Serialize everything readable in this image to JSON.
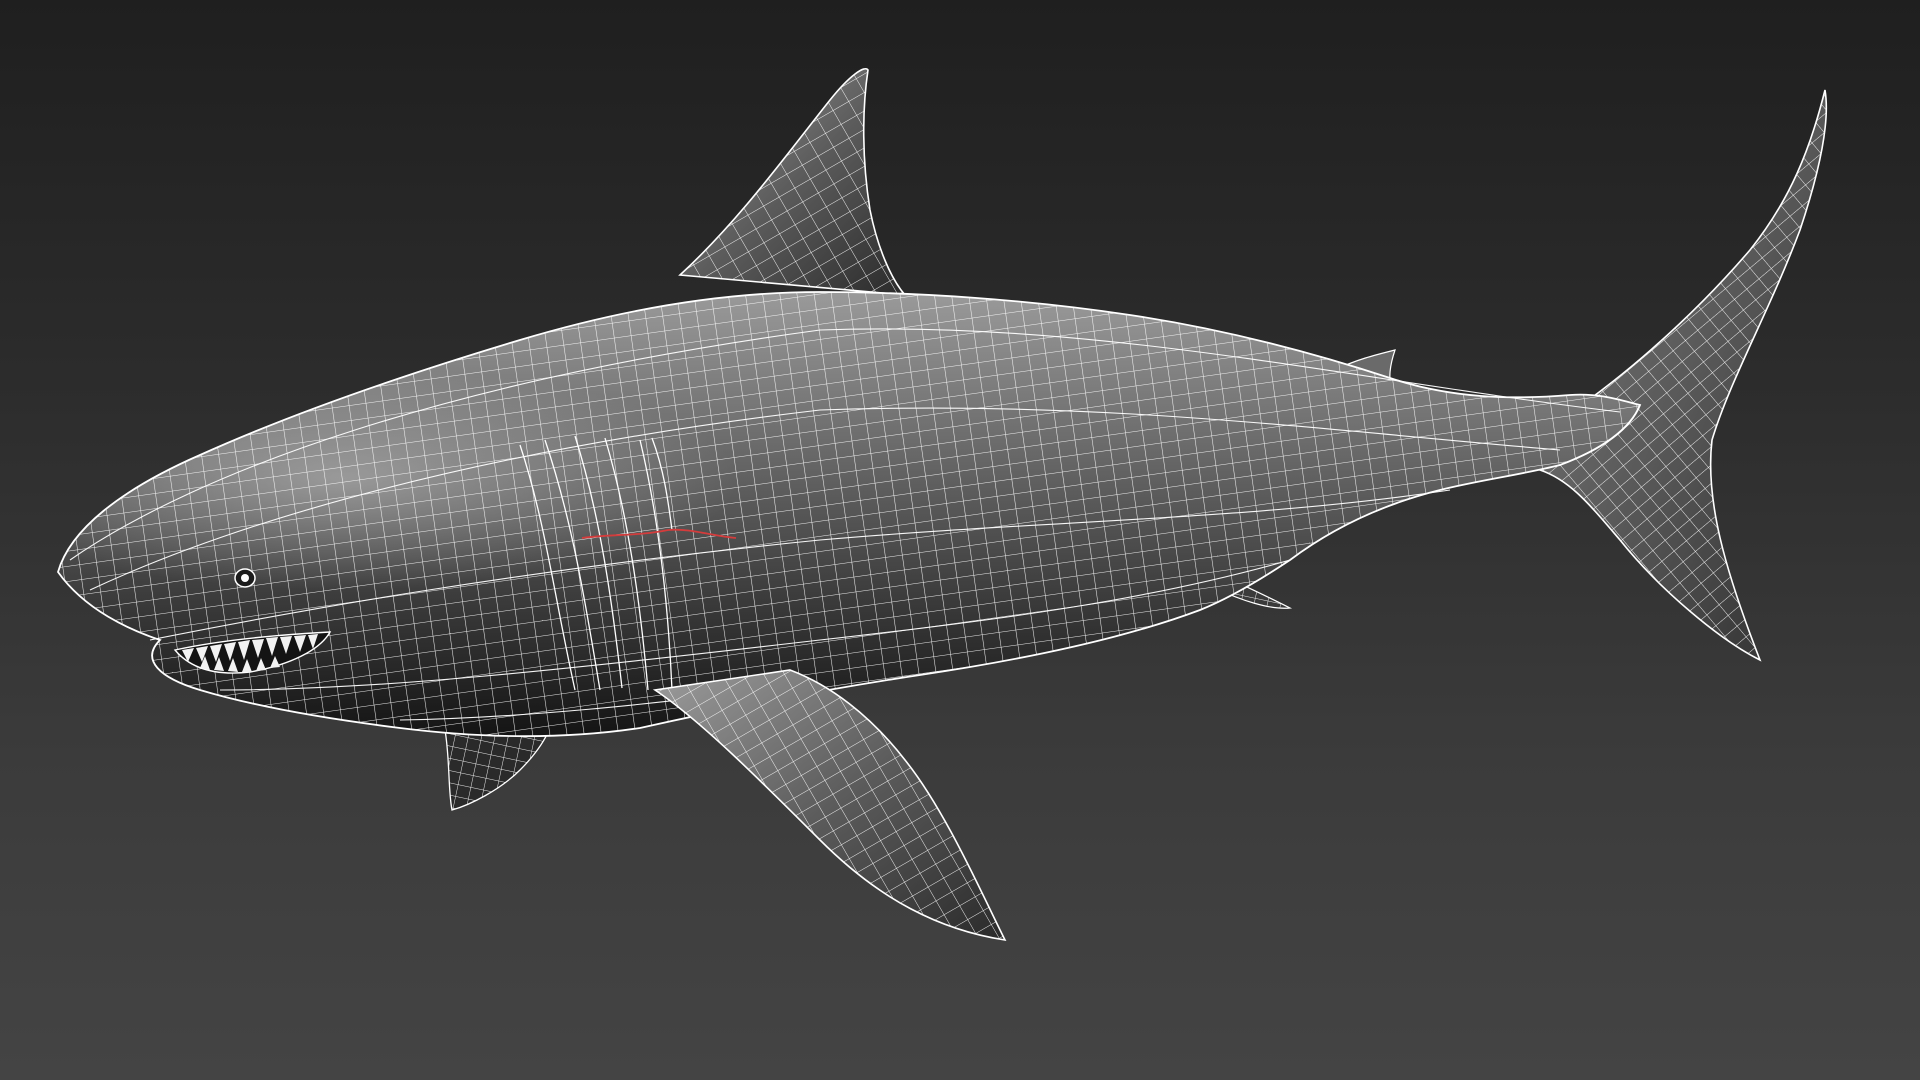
{
  "viewport": {
    "type": "3d-wireframe-viewport",
    "subject": "shark-mesh",
    "colors": {
      "background_top": "#1f1f1f",
      "background_bottom": "#444444",
      "mesh_fill_light": "#8e8e8e",
      "mesh_fill_dark": "#202020",
      "wire": "#ffffff",
      "selected_edge": "#d43c3c"
    }
  }
}
